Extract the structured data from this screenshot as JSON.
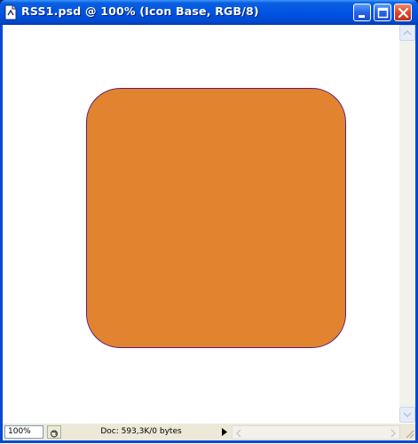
{
  "window": {
    "title": "RSS1.psd @ 100% (Icon Base, RGB/8)",
    "controls": [
      "minimize-icon",
      "maximize-icon",
      "close-icon"
    ]
  },
  "canvas": {
    "shape": "rounded-rectangle",
    "fill_color": "#e2832f",
    "stroke_color": "#5a1d7a"
  },
  "status_bar": {
    "zoom": "100%",
    "doc_info": "Doc: 593,3K/0 bytes"
  },
  "colors": {
    "titlebar": "#0054e3",
    "close_button": "#e0462a",
    "status_bar": "#ece9d8"
  }
}
